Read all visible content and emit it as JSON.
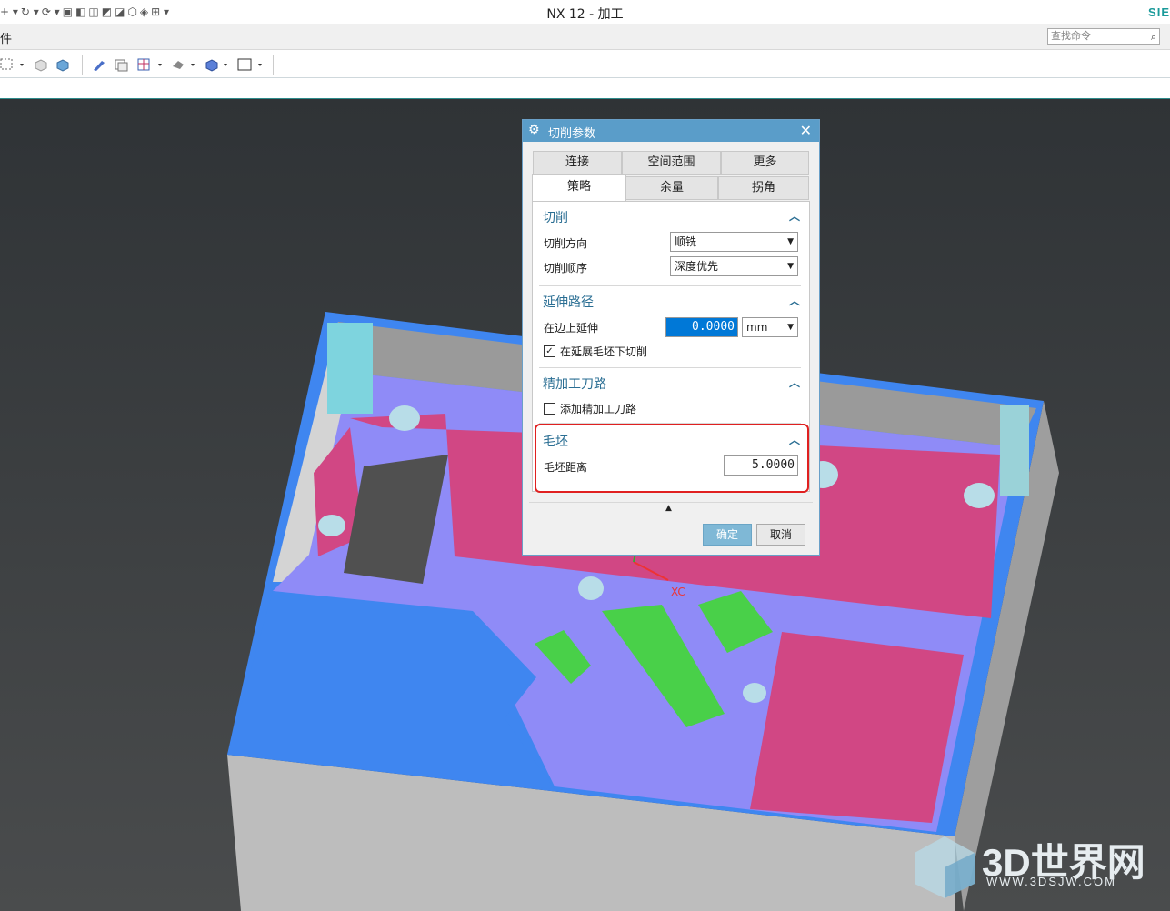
{
  "window": {
    "title": "NX 12 - 加工",
    "brand": "SIE"
  },
  "menubar": {
    "menu_label": "件",
    "search_placeholder": "查找命令"
  },
  "dialog": {
    "title": "切削参数",
    "tabs_row1": [
      "连接",
      "空间范围",
      "更多"
    ],
    "tabs_row2": [
      "策略",
      "余量",
      "拐角"
    ],
    "active_tab": "策略",
    "sections": {
      "cut": {
        "title": "切削",
        "direction_label": "切削方向",
        "direction_value": "顺铣",
        "order_label": "切削顺序",
        "order_value": "深度优先"
      },
      "extend": {
        "title": "延伸路径",
        "edge_label": "在边上延伸",
        "edge_value": "0.0000",
        "edge_unit": "mm",
        "cut_under_label": "在延展毛坯下切削",
        "cut_under_checked": true
      },
      "finish": {
        "title": "精加工刀路",
        "add_label": "添加精加工刀路",
        "add_checked": false
      },
      "blank": {
        "title": "毛坯",
        "distance_label": "毛坯距离",
        "distance_value": "5.0000"
      }
    },
    "ok_label": "确定",
    "cancel_label": "取消"
  },
  "axis": {
    "xc": "XC",
    "yc": "YC"
  },
  "watermark": {
    "text": "3D世界网",
    "url": "WWW.3DSJW.COM"
  },
  "colors": {
    "accent": "#5a9dc9",
    "highlight": "#e02020",
    "model_blue": "#3f86f0",
    "floor_purple": "#8f8bf7",
    "pink": "#d14784",
    "green": "#49d049"
  }
}
